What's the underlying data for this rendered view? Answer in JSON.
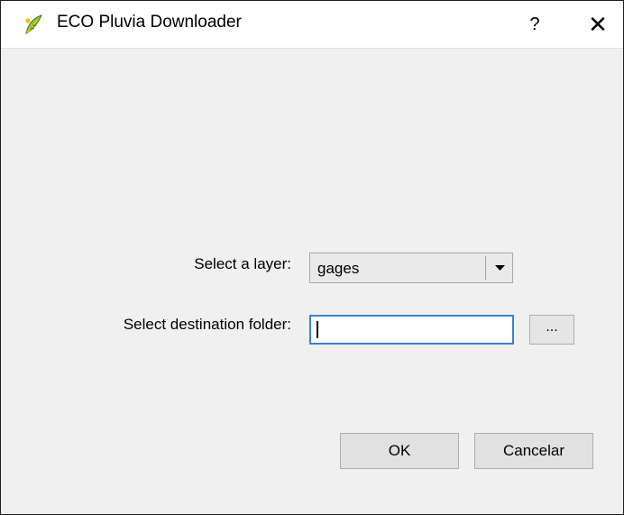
{
  "window": {
    "title": "ECO Pluvia Downloader",
    "icon": "qgis-leaf-icon",
    "help_label": "?",
    "close_label": "✕"
  },
  "form": {
    "layer_label": "Select a layer:",
    "layer_selected": "gages",
    "folder_label": "Select destination folder:",
    "folder_value": "",
    "browse_label": "..."
  },
  "buttons": {
    "ok_label": "OK",
    "cancel_label": "Cancelar"
  },
  "colors": {
    "focus_border": "#3c7fd1",
    "dialog_background": "#f0f0f0"
  }
}
